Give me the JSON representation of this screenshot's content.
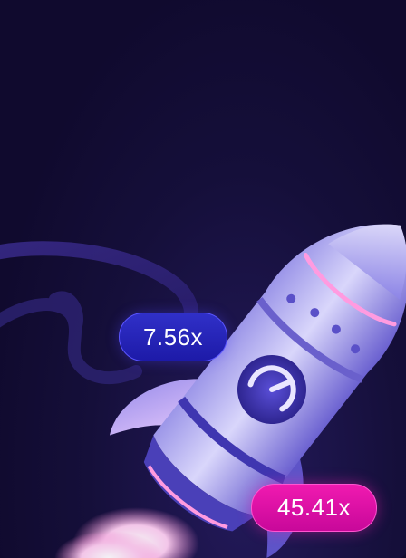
{
  "multipliers": {
    "primary": "7.56x",
    "secondary": "45.41x"
  },
  "colors": {
    "background": "#100a2e",
    "primary_badge": "#1d1aa8",
    "secondary_badge": "#d80ca4",
    "accent_glow": "#ff8ad8"
  },
  "icons": {
    "rocket": "rocket-icon",
    "dial": "gauge-icon",
    "trail": "ribbon-trail-icon"
  }
}
